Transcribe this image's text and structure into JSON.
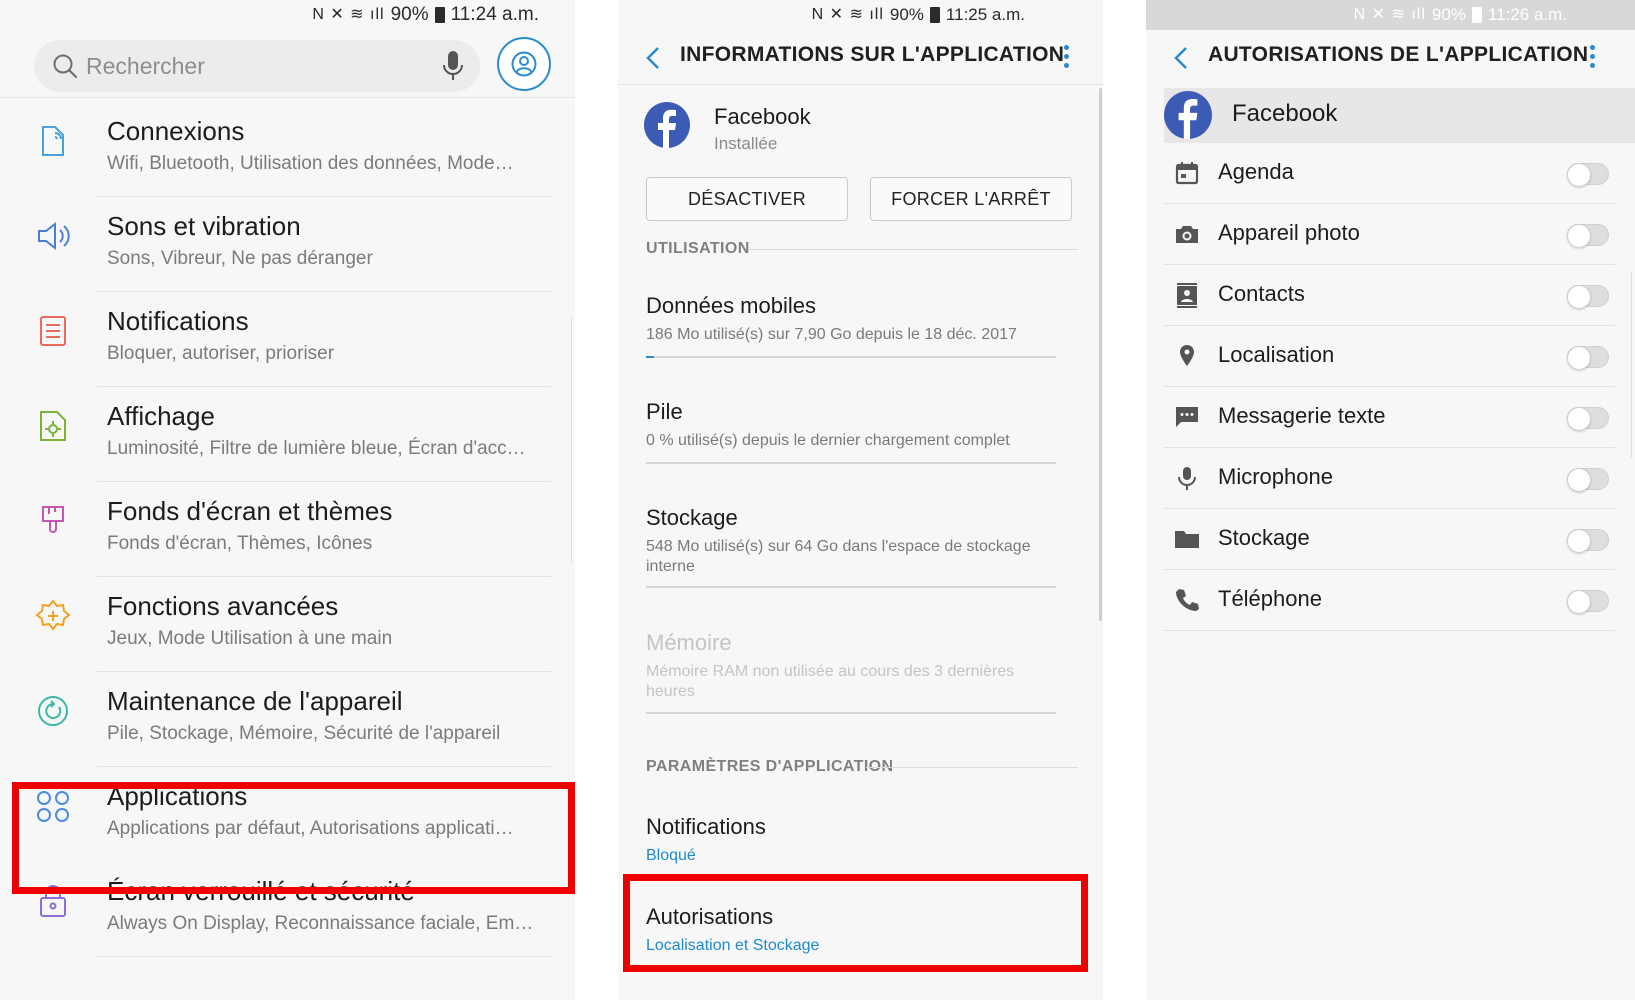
{
  "panel1": {
    "status": {
      "battery": "90%",
      "time": "11:24 a.m."
    },
    "search_placeholder": "Rechercher",
    "items": [
      {
        "title": "Connexions",
        "subtitle": "Wifi, Bluetooth, Utilisation des données, Mode…",
        "icon": "connections-icon"
      },
      {
        "title": "Sons et vibration",
        "subtitle": "Sons, Vibreur, Ne pas déranger",
        "icon": "speaker-icon"
      },
      {
        "title": "Notifications",
        "subtitle": "Bloquer, autoriser, prioriser",
        "icon": "notifications-icon"
      },
      {
        "title": "Affichage",
        "subtitle": "Luminosité, Filtre de lumière bleue, Écran d'acc…",
        "icon": "display-icon"
      },
      {
        "title": "Fonds d'écran et thèmes",
        "subtitle": "Fonds d'écran, Thèmes, Icônes",
        "icon": "brush-icon"
      },
      {
        "title": "Fonctions avancées",
        "subtitle": "Jeux, Mode Utilisation à une main",
        "icon": "advanced-features-icon"
      },
      {
        "title": "Maintenance de l'appareil",
        "subtitle": "Pile, Stockage, Mémoire, Sécurité de l'appareil",
        "icon": "maintenance-icon"
      },
      {
        "title": "Applications",
        "subtitle": "Applications par défaut, Autorisations applicati…",
        "icon": "apps-icon"
      },
      {
        "title": "Écran verrouillé et sécurité",
        "subtitle": "Always On Display, Reconnaissance faciale, Em…",
        "icon": "lock-icon"
      }
    ]
  },
  "panel2": {
    "status": {
      "battery": "90%",
      "time": "11:25 a.m."
    },
    "title": "INFORMATIONS SUR L'APPLICATION",
    "app_name": "Facebook",
    "app_status": "Installée",
    "buttons": {
      "disable": "DÉSACTIVER",
      "force_stop": "FORCER L'ARRÊT"
    },
    "section_usage": "UTILISATION",
    "mobile_data": {
      "title": "Données mobiles",
      "subtitle": "186 Mo utilisé(s) sur 7,90 Go depuis le 18 déc. 2017"
    },
    "battery": {
      "title": "Pile",
      "subtitle": "0 % utilisé(s) depuis le dernier chargement complet"
    },
    "storage": {
      "title": "Stockage",
      "subtitle": "548 Mo utilisé(s) sur 64 Go dans l'espace de stockage interne"
    },
    "memory": {
      "title": "Mémoire",
      "subtitle": "Mémoire RAM non utilisée au cours des 3 dernières heures"
    },
    "section_settings": "PARAMÈTRES D'APPLICATION",
    "notifications": {
      "title": "Notifications",
      "subtitle": "Bloqué"
    },
    "permissions": {
      "title": "Autorisations",
      "subtitle": "Localisation et Stockage"
    }
  },
  "panel3": {
    "status": {
      "battery": "90%",
      "time": "11:26 a.m."
    },
    "title": "AUTORISATIONS DE L'APPLICATION",
    "app_name": "Facebook",
    "permissions": [
      {
        "label": "Agenda",
        "icon": "calendar-icon",
        "enabled": false
      },
      {
        "label": "Appareil photo",
        "icon": "camera-icon",
        "enabled": false
      },
      {
        "label": "Contacts",
        "icon": "contacts-icon",
        "enabled": false
      },
      {
        "label": "Localisation",
        "icon": "location-pin-icon",
        "enabled": false
      },
      {
        "label": "Messagerie texte",
        "icon": "message-icon",
        "enabled": false
      },
      {
        "label": "Microphone",
        "icon": "microphone-icon",
        "enabled": false
      },
      {
        "label": "Stockage",
        "icon": "folder-icon",
        "enabled": false
      },
      {
        "label": "Téléphone",
        "icon": "phone-icon",
        "enabled": false
      }
    ]
  },
  "colors": {
    "accent": "#2a8ccf",
    "highlight": "#ef0000",
    "facebook": "#3b5bb5"
  }
}
